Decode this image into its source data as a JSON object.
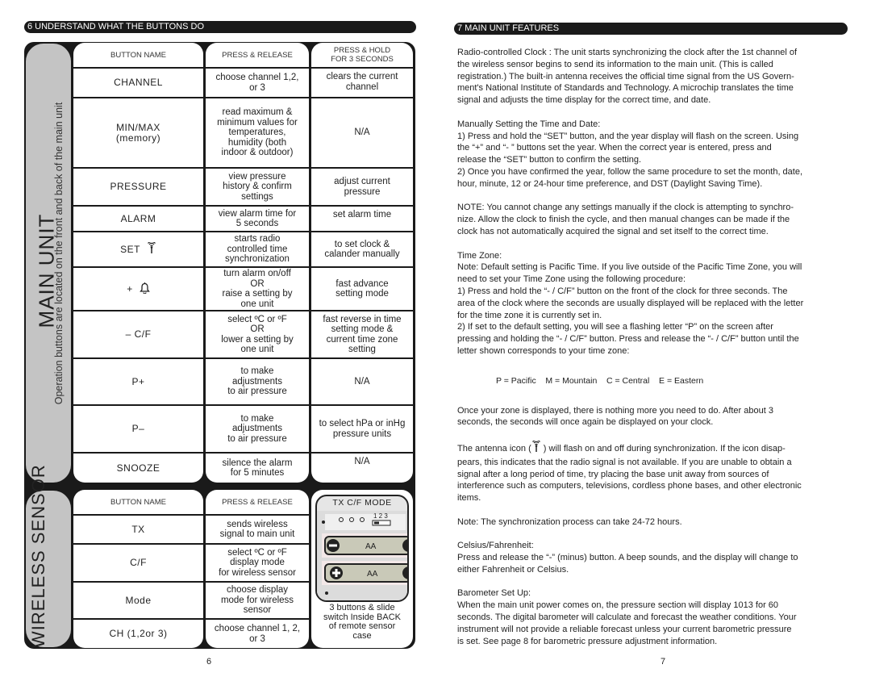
{
  "left": {
    "section_title": "6 UNDERSTAND WHAT THE BUTTONS DO",
    "main_unit": {
      "title": "MAIN UNIT",
      "note": "Operation buttons are located on the front and back of the main unit",
      "headers": [
        "BUTTON NAME",
        "PRESS & RELEASE",
        "PRESS & HOLD\nFOR 3 SECONDS"
      ],
      "rows": [
        {
          "name": "CHANNEL",
          "press": "choose channel 1,2,\nor 3",
          "hold": "clears the current\nchannel",
          "hold_top": true
        },
        {
          "name": "MIN/MAX\n(memory)",
          "press": "read maximum &\nminimum values for\ntemperatures,\nhumidity (both\nindoor & outdoor)",
          "hold": "N/A"
        },
        {
          "name": "PRESSURE",
          "press": "view pressure\nhistory & confirm\nsettings",
          "hold": "adjust current\npressure"
        },
        {
          "name": "ALARM",
          "press": "view alarm time for\n5 seconds",
          "hold": "set alarm time",
          "hold_top": true
        },
        {
          "name": "SET",
          "icon": "antenna-icon",
          "press": "starts radio\ncontrolled time\nsynchronization",
          "hold": "to set clock &\ncalander manually"
        },
        {
          "name": "+",
          "icon": "bell-icon",
          "press": "turn alarm on/off\nOR\nraise a setting by\none unit",
          "hold": "fast advance\nsetting mode"
        },
        {
          "name": "– C/F",
          "press": "select ºC or ºF\nOR\nlower a setting by\none unit",
          "hold": "fast reverse in time\nsetting mode &\ncurrent time zone\nsetting"
        },
        {
          "name": "P+",
          "press": "to make\nadjustments\nto air pressure",
          "hold": "N/A"
        },
        {
          "name": "P–",
          "press": "to make\nadjustments\nto air pressure",
          "hold": "to select hPa or inHg\npressure units"
        },
        {
          "name": "SNOOZE",
          "press": "silence the alarm\nfor 5 minutes",
          "hold": "N/A",
          "hold_top": true
        }
      ]
    },
    "wireless_sensor": {
      "title": "WIRELESS SENSOR",
      "headers": [
        "BUTTON NAME",
        "PRESS & RELEASE"
      ],
      "rows": [
        {
          "name": "TX",
          "press": "sends wireless\nsignal to main unit"
        },
        {
          "name": "C/F",
          "press": "select ºC or ºF\ndisplay mode\nfor wireless sensor"
        },
        {
          "name": "Mode",
          "press": "choose display\nmode for wireless\nsensor"
        },
        {
          "name": "CH (1,2or 3)",
          "press": "choose channel 1, 2,\nor 3"
        }
      ],
      "image_label": "TX  C/F  MODE",
      "switch_label": "1 2 3",
      "battery_label": "AA",
      "caption": "3 buttons & slide\nswitch Inside BACK\nof remote sensor\ncase"
    },
    "page_number": "6"
  },
  "right": {
    "section_title": "7 MAIN UNIT FEATURES",
    "paragraphs": [
      {
        "heading": "",
        "text": "Radio-controlled Clock : The unit starts synchronizing the clock after the 1st channel of\nthe wireless sensor begins to send its information to the main unit. (This is called\nregistration.) The built-in antenna receives the official time signal from the US Govern-\nment's National Institute of Standards and Technology. A microchip translates the time\nsignal and adjusts the time display for the correct time, and date."
      },
      {
        "heading": "Manually Setting the Time and Date:",
        "text": "1) Press and hold the “SET” button, and the year display will flash on the screen. Using\nthe “+” and “- ” buttons set the year. When the correct year is entered, press and\nrelease the “SET” button to confirm the setting.\n2) Once you have confirmed the year, follow the same procedure to set the month, date,\nhour, minute, 12 or 24-hour time preference, and DST (Daylight Saving Time)."
      },
      {
        "heading": "",
        "text": "NOTE: You cannot change any settings manually if the clock is attempting to synchro-\nnize. Allow the clock to finish the cycle, and then manual changes can be made if the\nclock has not automatically acquired the signal and set itself to the correct time."
      },
      {
        "heading": "Time Zone:",
        "text": "Note: Default setting is Pacific Time. If you live outside of the Pacific Time Zone, you will\nneed to set your Time Zone using the following procedure:\n1) Press and hold the “- / C/F” button on the front of the clock for three seconds. The\narea of the clock where the seconds are usually displayed will be replaced with the letter\nfor the time zone it is currently set in.\n2) If set to the default setting, you will see a flashing letter “P” on the screen after\npressing and holding the “- / C/F” button. Press and release the “- / C/F” button until the\nletter shown corresponds to your time zone:"
      }
    ],
    "zones": "P = Pacific    M = Mountain    C = Central    E = Eastern",
    "paragraphs2": [
      {
        "heading": "",
        "text": "Once your zone is displayed, there is nothing more you need to do. After about 3\nseconds, the seconds will once again be displayed on your clock."
      },
      {
        "heading": "",
        "text_before_icon": "The antenna icon (",
        "text": " ) will flash on and off during synchronization. If the icon disap-\npears, this indicates that the radio signal is not available. If you are unable to obtain a\nsignal after a long period of time, try placing the base unit away from sources of\ninterference such as computers, televisions, cordless phone bases, and other electronic\nitems."
      },
      {
        "heading": "",
        "text": "Note: The synchronization process can take 24-72 hours."
      },
      {
        "heading": "Celsius/Fahrenheit:",
        "text": "Press and release the “-” (minus) button. A beep sounds, and the display will change to\neither Fahrenheit or Celsius."
      },
      {
        "heading": "Barometer Set Up:",
        "text": "When the main unit power comes on, the pressure section will display 1013 for 60\nseconds. The digital barometer will calculate and forecast the weather conditions. Your\ninstrument will not provide a reliable forecast unless your current barometric pressure\nis set. See page 8 for barometric pressure adjustment information."
      }
    ],
    "page_number": "7"
  }
}
